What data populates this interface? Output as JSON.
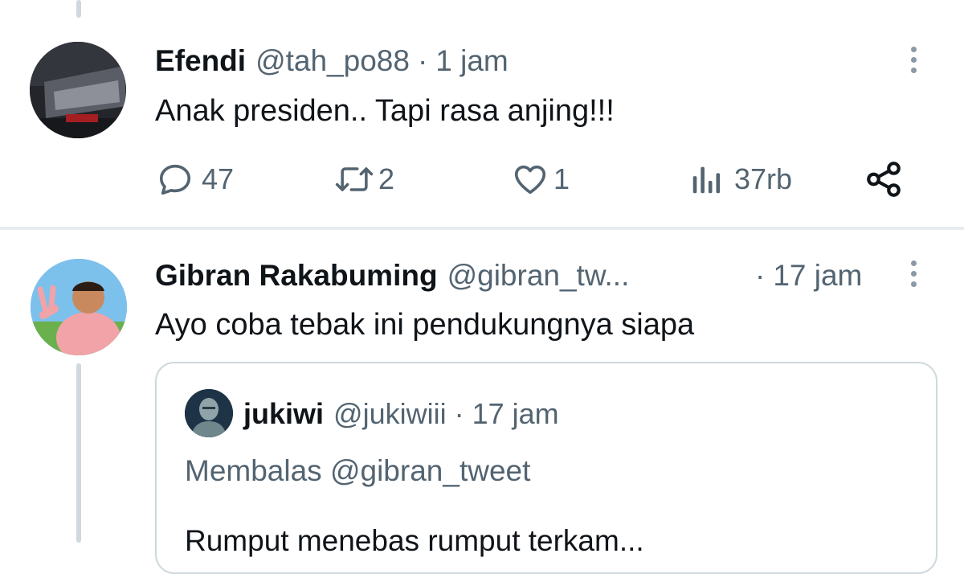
{
  "tweet1": {
    "name": "Efendi",
    "handle": "@tah_po88",
    "separator": "·",
    "time": "1 jam",
    "text": "Anak presiden.. Tapi rasa anjing!!!",
    "stats": {
      "replies": "47",
      "retweets": "2",
      "likes": "1",
      "views": "37rb"
    },
    "icons": [
      "reply-icon",
      "retweet-icon",
      "like-icon",
      "views-icon",
      "share-icon"
    ]
  },
  "tweet2": {
    "name": "Gibran Rakabuming",
    "handle": "@gibran_tw...",
    "separator": "·",
    "time": "17 jam",
    "text": "Ayo coba tebak ini pendukungnya siapa",
    "quote": {
      "name": "jukiwi",
      "handle": "@jukiwiii",
      "separator": "·",
      "time": "17 jam",
      "reply_to": "Membalas @gibran_tweet",
      "text": "Rumput menebas rumput terkam..."
    }
  },
  "colors": {
    "text": "#0f1419",
    "muted": "#536471",
    "border": "#cfd9de",
    "thread": "#cfd9de"
  }
}
